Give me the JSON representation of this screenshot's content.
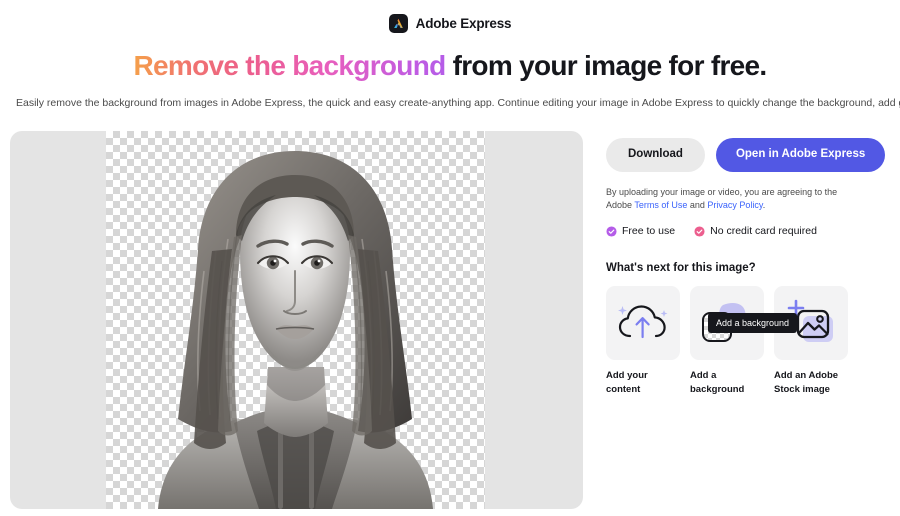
{
  "brand": {
    "name": "Adobe Express",
    "logo_icon": "adobe-express-logo-icon"
  },
  "headline": {
    "highlight": "Remove the background",
    "rest": " from your image for free."
  },
  "subtitle": "Easily remove the background from images in Adobe Express, the quick and easy create-anything app. Continue editing your image in Adobe Express to quickly change the background, add graphics, and more.",
  "preview": {
    "alt": "Grayscale portrait of a woman with long wavy hair wearing a hooded jacket, background removed",
    "transparency_pattern": "checkerboard"
  },
  "actions": {
    "download_label": "Download",
    "open_label": "Open in Adobe Express"
  },
  "legal": {
    "prefix": "By uploading your image or video, you are agreeing to the Adobe ",
    "terms_link": "Terms of Use",
    "conjunction": " and ",
    "privacy_link": "Privacy Policy",
    "suffix": "."
  },
  "bullets": [
    {
      "label": "Free to use",
      "color": "#b45ce8",
      "icon": "check-circle-icon"
    },
    {
      "label": "No credit card required",
      "color": "#ec5e8e",
      "icon": "check-circle-icon"
    }
  ],
  "whats_next": {
    "title": "What's next for this image?",
    "cards": [
      {
        "label": "Add your content",
        "icon": "cloud-upload-icon"
      },
      {
        "label": "Add a background",
        "icon": "layers-background-icon",
        "tooltip": "Add a background"
      },
      {
        "label": "Add an Adobe Stock image",
        "icon": "add-image-icon"
      }
    ]
  },
  "colors": {
    "accent_purple": "#5258e4",
    "link_blue": "#3b63fb",
    "text_dark": "#16171c",
    "tile_bg": "#f3f3f4",
    "preview_bg": "#e4e4e4"
  }
}
